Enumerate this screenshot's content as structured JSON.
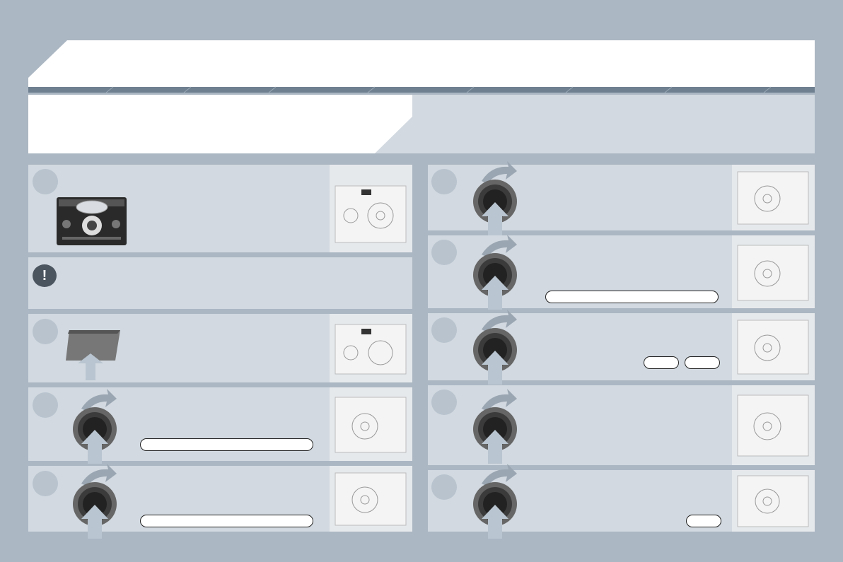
{
  "colors": {
    "page_background": "#abb7c3",
    "panel": "#d2d9e0",
    "header_band": "#ffffff",
    "stripe": "#6f8090",
    "step_circle": "#b8c3ce"
  },
  "icons": {
    "warning": "exclamation-icon",
    "rotate": "rotate-arrow-icon",
    "press": "press-up-arrow-icon",
    "knob": "control-knob-icon",
    "insert": "card-insert-icon"
  },
  "warning": {
    "symbol": "!"
  }
}
